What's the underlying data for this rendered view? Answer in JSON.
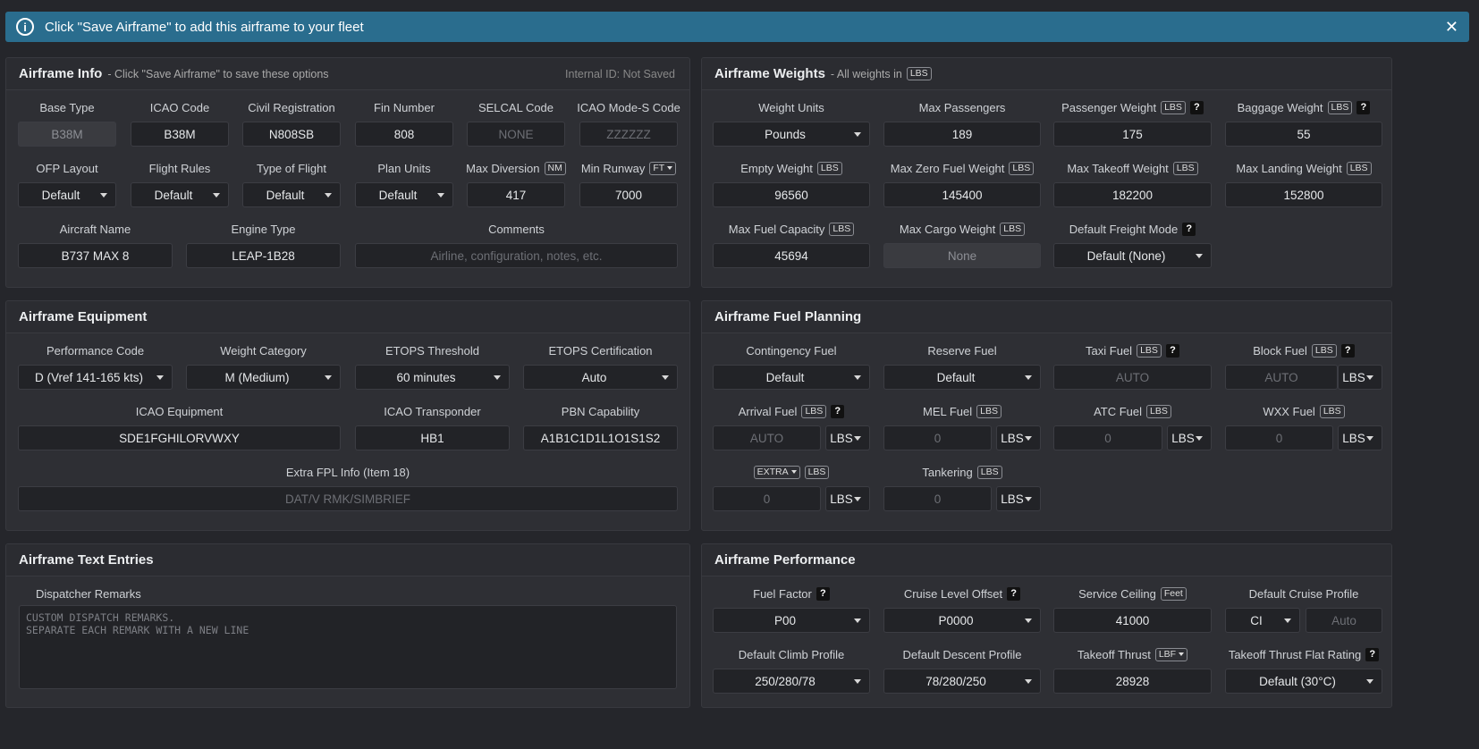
{
  "banner": {
    "text": "Click \"Save Airframe\" to add this airframe to your fleet",
    "info_icon": "i",
    "close_icon": "✕"
  },
  "info": {
    "title": "Airframe Info",
    "subtitle": "- Click \"Save Airframe\" to save these options",
    "internal_id": "Internal ID: Not Saved",
    "base_type": {
      "label": "Base Type",
      "value": "B38M"
    },
    "icao_code": {
      "label": "ICAO Code",
      "value": "B38M"
    },
    "civil_reg": {
      "label": "Civil Registration",
      "value": "N808SB"
    },
    "fin_number": {
      "label": "Fin Number",
      "value": "808"
    },
    "selcal": {
      "label": "SELCAL Code",
      "placeholder": "NONE"
    },
    "modes": {
      "label": "ICAO Mode-S Code",
      "placeholder": "ZZZZZZ"
    },
    "ofp_layout": {
      "label": "OFP Layout",
      "value": "Default"
    },
    "flight_rules": {
      "label": "Flight Rules",
      "value": "Default"
    },
    "type_flight": {
      "label": "Type of Flight",
      "value": "Default"
    },
    "plan_units": {
      "label": "Plan Units",
      "value": "Default"
    },
    "max_diversion": {
      "label": "Max Diversion",
      "unit": "NM",
      "value": "417"
    },
    "min_runway": {
      "label": "Min Runway",
      "unit": "FT",
      "value": "7000"
    },
    "aircraft_name": {
      "label": "Aircraft Name",
      "value": "B737 MAX 8"
    },
    "engine_type": {
      "label": "Engine Type",
      "value": "LEAP-1B28"
    },
    "comments": {
      "label": "Comments",
      "placeholder": "Airline, configuration, notes, etc."
    }
  },
  "weights": {
    "title": "Airframe Weights",
    "subtitle": "- All weights in",
    "unit": "LBS",
    "weight_units": {
      "label": "Weight Units",
      "value": "Pounds"
    },
    "max_pax": {
      "label": "Max Passengers",
      "value": "189"
    },
    "pax_weight": {
      "label": "Passenger Weight",
      "unit": "LBS",
      "value": "175"
    },
    "bag_weight": {
      "label": "Baggage Weight",
      "unit": "LBS",
      "value": "55"
    },
    "empty": {
      "label": "Empty Weight",
      "unit": "LBS",
      "value": "96560"
    },
    "mzfw": {
      "label": "Max Zero Fuel Weight",
      "unit": "LBS",
      "value": "145400"
    },
    "mtow": {
      "label": "Max Takeoff Weight",
      "unit": "LBS",
      "value": "182200"
    },
    "mlw": {
      "label": "Max Landing Weight",
      "unit": "LBS",
      "value": "152800"
    },
    "fuel_cap": {
      "label": "Max Fuel Capacity",
      "unit": "LBS",
      "value": "45694"
    },
    "cargo": {
      "label": "Max Cargo Weight",
      "unit": "LBS",
      "placeholder": "None"
    },
    "freight": {
      "label": "Default Freight Mode",
      "value": "Default (None)"
    }
  },
  "equip": {
    "title": "Airframe Equipment",
    "perf_code": {
      "label": "Performance Code",
      "value": "D (Vref 141-165 kts)"
    },
    "weight_cat": {
      "label": "Weight Category",
      "value": "M (Medium)"
    },
    "etops_thr": {
      "label": "ETOPS Threshold",
      "value": "60 minutes"
    },
    "etops_cert": {
      "label": "ETOPS Certification",
      "value": "Auto"
    },
    "icao_equip": {
      "label": "ICAO Equipment",
      "value": "SDE1FGHILORVWXY"
    },
    "icao_trans": {
      "label": "ICAO Transponder",
      "value": "HB1"
    },
    "pbn": {
      "label": "PBN Capability",
      "value": "A1B1C1D1L1O1S1S2"
    },
    "extra_fpl": {
      "label": "Extra FPL Info (Item 18)",
      "placeholder": "DAT/V RMK/SIMBRIEF"
    }
  },
  "fuel": {
    "title": "Airframe Fuel Planning",
    "lbs": "LBS",
    "contingency": {
      "label": "Contingency Fuel",
      "value": "Default"
    },
    "reserve": {
      "label": "Reserve Fuel",
      "value": "Default"
    },
    "taxi": {
      "label": "Taxi Fuel",
      "unit": "LBS",
      "placeholder": "AUTO"
    },
    "block": {
      "label": "Block Fuel",
      "unit": "LBS",
      "placeholder": "AUTO"
    },
    "arrival": {
      "label": "Arrival Fuel",
      "unit": "LBS",
      "placeholder": "AUTO"
    },
    "mel": {
      "label": "MEL Fuel",
      "unit": "LBS",
      "placeholder": "0"
    },
    "atc": {
      "label": "ATC Fuel",
      "unit": "LBS",
      "placeholder": "0"
    },
    "wxx": {
      "label": "WXX Fuel",
      "unit": "LBS",
      "placeholder": "0"
    },
    "extra": {
      "label": "EXTRA",
      "unit": "LBS",
      "placeholder": "0"
    },
    "tankering": {
      "label": "Tankering",
      "unit": "LBS",
      "placeholder": "0"
    }
  },
  "text": {
    "title": "Airframe Text Entries",
    "remarks_label": "Dispatcher Remarks",
    "remarks_placeholder": "CUSTOM DISPATCH REMARKS.\nSEPARATE EACH REMARK WITH A NEW LINE"
  },
  "perf": {
    "title": "Airframe Performance",
    "fuel_factor": {
      "label": "Fuel Factor",
      "value": "P00"
    },
    "cruise_offset": {
      "label": "Cruise Level Offset",
      "value": "P0000"
    },
    "ceiling": {
      "label": "Service Ceiling",
      "unit": "Feet",
      "value": "41000"
    },
    "cruise_profile": {
      "label": "Default Cruise Profile",
      "value": "CI",
      "placeholder": "Auto"
    },
    "climb": {
      "label": "Default Climb Profile",
      "value": "250/280/78"
    },
    "descent": {
      "label": "Default Descent Profile",
      "value": "78/280/250"
    },
    "thrust": {
      "label": "Takeoff Thrust",
      "unit": "LBF",
      "value": "28928"
    },
    "flat_rating": {
      "label": "Takeoff Thrust Flat Rating",
      "value": "Default (30°C)"
    }
  }
}
